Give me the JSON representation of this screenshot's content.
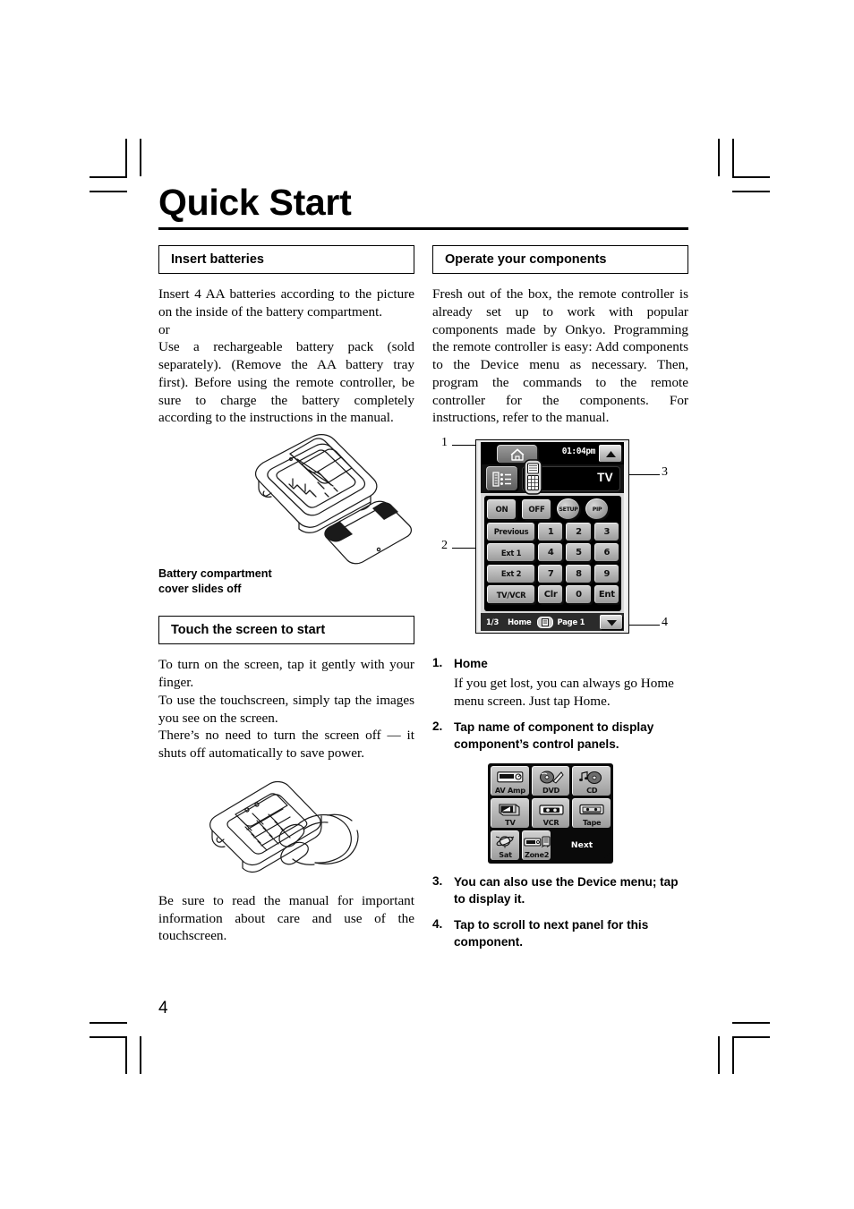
{
  "page": {
    "title": "Quick Start",
    "page_number": "4"
  },
  "left_column": {
    "section1": {
      "heading": "Insert batteries",
      "paragraph": "Insert 4 AA batteries according to the picture on the inside of the battery compartment.\nor\nUse a rechargeable battery pack (sold separately). (Remove the AA battery tray first). Before using the remote controller, be sure to charge the battery completely according to the instructions in the manual.",
      "p1": "Insert 4 AA batteries according to the picture on the inside of the battery compartment.",
      "p2": "or",
      "p3": "Use a rechargeable battery pack (sold separately). (Remove the AA battery tray first). Before using the remote controller, be sure to charge the battery completely according to the instructions in the manual.",
      "figure_caption": "Battery compartment\ncover slides off",
      "figure_caption_line1": "Battery compartment",
      "figure_caption_line2": "cover slides off",
      "figure_name": "remote-battery-compartment-illustration"
    },
    "section2": {
      "heading": "Touch the screen to start",
      "p1": "To turn on the screen, tap it gently with your finger.",
      "p2": "To use the touchscreen, simply tap the images you see on the screen.",
      "p3": "There’s no need to turn the screen off — it shuts off automatically to save power.",
      "p4": "Be sure to read the manual for important information about care and use of the touchscreen.",
      "figure_name": "hand-tapping-remote-illustration"
    }
  },
  "right_column": {
    "section1": {
      "heading": "Operate your components",
      "p1": "Fresh out of the box, the remote controller is already set up to work with popular components made by Onkyo. Programming the remote controller is easy: Add components to the Device menu as necessary. Then, program the commands to the remote controller  for the components. For instructions, refer to the manual."
    },
    "callouts": {
      "one": "1",
      "two": "2",
      "three": "3",
      "four": "4"
    },
    "lcd_screen": {
      "home_icon": "home-icon",
      "clock": "01:04pm",
      "scroll_up_icon": "▲",
      "scroll_down_icon": "▼",
      "menu_icon": "list-menu-icon",
      "device_icon": "remote-device-icon",
      "device_name": "TV",
      "keys": [
        [
          "ON",
          "OFF",
          "SETUP",
          "PIP"
        ],
        [
          "Previous",
          "1",
          "2",
          "3"
        ],
        [
          "Ext 1",
          "4",
          "5",
          "6"
        ],
        [
          "Ext 2",
          "7",
          "8",
          "9"
        ],
        [
          "TV/VCR",
          "Clr",
          "0",
          "Ent"
        ]
      ],
      "status_bar": {
        "panel_index": "1/3",
        "home_label": "Home",
        "center_icon": "panel-icon",
        "page_label": "Page 1"
      }
    },
    "steps": [
      {
        "num": "1.",
        "heading": "Home",
        "body": "If you get lost, you can always go Home menu screen. Just tap Home."
      },
      {
        "num": "2.",
        "heading": "Tap name of component to display component’s control panels.",
        "body": ""
      },
      {
        "num": "3.",
        "heading": "You can also use the Device menu; tap to display it.",
        "body": ""
      },
      {
        "num": "4.",
        "heading": "Tap to scroll to next panel for this component.",
        "body": ""
      }
    ],
    "device_menu": {
      "rows": [
        [
          {
            "label": "AV Amp",
            "icon": "av-amp-icon"
          },
          {
            "label": "DVD",
            "icon": "dvd-icon"
          },
          {
            "label": "CD",
            "icon": "cd-icon"
          }
        ],
        [
          {
            "label": "TV",
            "icon": "tv-icon"
          },
          {
            "label": "VCR",
            "icon": "vcr-icon"
          },
          {
            "label": "Tape",
            "icon": "tape-icon"
          }
        ],
        [
          {
            "label": "Sat",
            "icon": "satellite-icon"
          },
          {
            "label": "Zone2",
            "icon": "zone2-icon"
          },
          {
            "label": "Next",
            "icon": "next-label"
          }
        ]
      ]
    }
  },
  "colors": {
    "ink": "#000000",
    "paper": "#ffffff",
    "lcd_body": "#d8d8d8",
    "lcd_key": "#b8b8b8",
    "lcd_dark": "#000000"
  }
}
